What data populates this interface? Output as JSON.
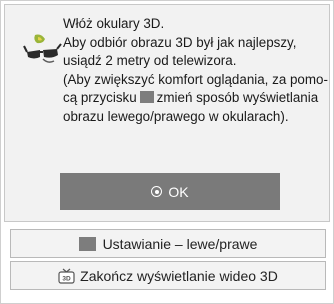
{
  "dialog": {
    "message_lines": [
      "Włóż okulary 3D.",
      "Aby odbiór obrazu 3D był jak najlepszy,",
      "usiądź 2 metry od telewizora.",
      "(Aby zwiększyć komfort oglądania, za pomo-",
      "cą przycisku",
      "zmień sposób wyświetlania",
      "obrazu lewego/prawego w okularach)."
    ],
    "ok_label": "OK",
    "options": {
      "left_right_label": "Ustawianie – lewe/prawe",
      "exit_3d_label": "Zakończ wyświetlanie wideo 3D"
    },
    "icons": {
      "glasses": "3d-glasses-icon",
      "ok": "ok-circle-icon",
      "color_key": "color-key-icon",
      "tv_3d": "tv-3d-icon"
    },
    "colors": {
      "ok_button": "#7a7a7a",
      "color_key": "#7d7d7d",
      "panel": "#f2f2f2"
    }
  }
}
